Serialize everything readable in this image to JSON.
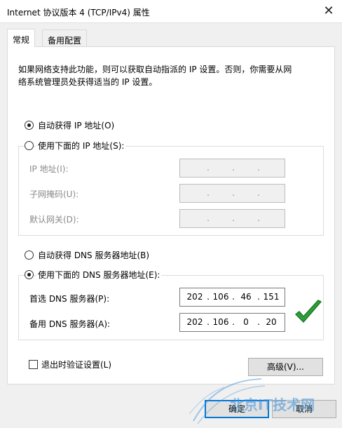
{
  "window": {
    "title": "Internet 协议版本 4 (TCP/IPv4) 属性",
    "close_icon": "close-icon"
  },
  "tabs": [
    {
      "label": "常规",
      "active": true
    },
    {
      "label": "备用配置",
      "active": false
    }
  ],
  "description": {
    "line1": "如果网络支持此功能，则可以获取自动指派的 IP 设置。否则，你需要从网",
    "line2": "络系统管理员处获得适当的 IP 设置。"
  },
  "ip_section": {
    "auto_label": "自动获得 IP 地址(O)",
    "manual_label": "使用下面的 IP 地址(S):",
    "auto_selected": true,
    "fields": [
      {
        "label": "IP 地址(I):",
        "value": [
          " ",
          " ",
          " ",
          " "
        ]
      },
      {
        "label": "子网掩码(U):",
        "value": [
          " ",
          " ",
          " ",
          " "
        ]
      },
      {
        "label": "默认网关(D):",
        "value": [
          " ",
          " ",
          " ",
          " "
        ]
      }
    ]
  },
  "dns_section": {
    "auto_label": "自动获得 DNS 服务器地址(B)",
    "manual_label": "使用下面的 DNS 服务器地址(E):",
    "manual_selected": true,
    "preferred": {
      "label": "首选 DNS 服务器(P):",
      "octets": [
        "202",
        "106",
        "46",
        "151"
      ]
    },
    "alternate": {
      "label": "备用 DNS 服务器(A):",
      "octets": [
        "202",
        "106",
        "0",
        "20"
      ]
    }
  },
  "validate_checkbox": {
    "label": "退出时验证设置(L)",
    "checked": false
  },
  "buttons": {
    "advanced": "高级(V)...",
    "ok": "确定",
    "cancel": "取消"
  },
  "colors": {
    "check_mark": "#2e9e3a",
    "watermark": "#3a8fd8"
  },
  "watermark_text": "北京IT技术网"
}
